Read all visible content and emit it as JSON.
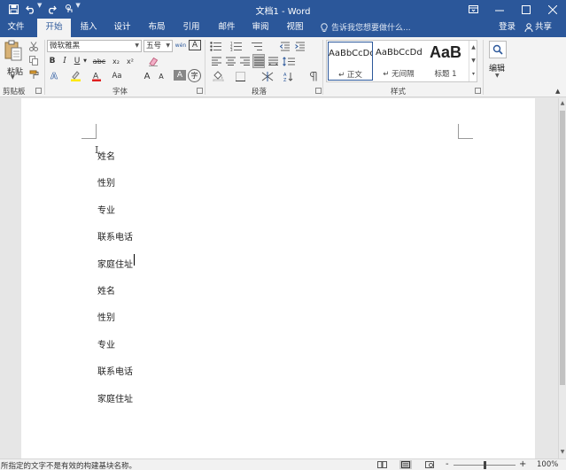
{
  "window": {
    "title": "文档1 - Word"
  },
  "tabs": [
    {
      "label": "文件"
    },
    {
      "label": "开始"
    },
    {
      "label": "插入"
    },
    {
      "label": "设计"
    },
    {
      "label": "布局"
    },
    {
      "label": "引用"
    },
    {
      "label": "邮件"
    },
    {
      "label": "审阅"
    },
    {
      "label": "视图"
    }
  ],
  "active_tab": "开始",
  "tell_me": "告诉我您想要做什么...",
  "account": {
    "login": "登录",
    "share": "共享"
  },
  "ribbon": {
    "clipboard": {
      "paste_label": "粘贴",
      "group_label": "剪贴板"
    },
    "font": {
      "font_name": "微软雅黑",
      "font_size": "五号",
      "group_label": "字体",
      "bold": "B",
      "italic": "I",
      "underline": "U",
      "strike": "abc",
      "subscript": "x₂",
      "superscript": "x²",
      "grow": "A",
      "shrink": "A",
      "case": "Aa",
      "clear": "A",
      "phonetic": "wén",
      "border_char": "A",
      "char_shade": "A",
      "circle_char": "字"
    },
    "paragraph": {
      "group_label": "段落"
    },
    "styles": {
      "group_label": "样式",
      "items": [
        {
          "sample": "AaBbCcDd",
          "name": "↵ 正文"
        },
        {
          "sample": "AaBbCcDd",
          "name": "↵ 无间隔"
        },
        {
          "sample": "AaB",
          "name": "标题 1"
        }
      ]
    },
    "editing": {
      "label": "编辑"
    }
  },
  "document": {
    "paragraphs": [
      "姓名",
      "性别",
      "专业",
      "联系电话",
      "家庭住址",
      "姓名",
      "性别",
      "专业",
      "联系电话",
      "家庭住址"
    ]
  },
  "status": {
    "message": "所指定的文字不是有效的构建基块名称。",
    "zoom": "100%",
    "zoom_minus": "-",
    "zoom_plus": "+"
  },
  "colors": {
    "accent": "#2b579a",
    "ribbon_bg": "#f3f3f3",
    "doc_bg": "#e6e6e6"
  }
}
